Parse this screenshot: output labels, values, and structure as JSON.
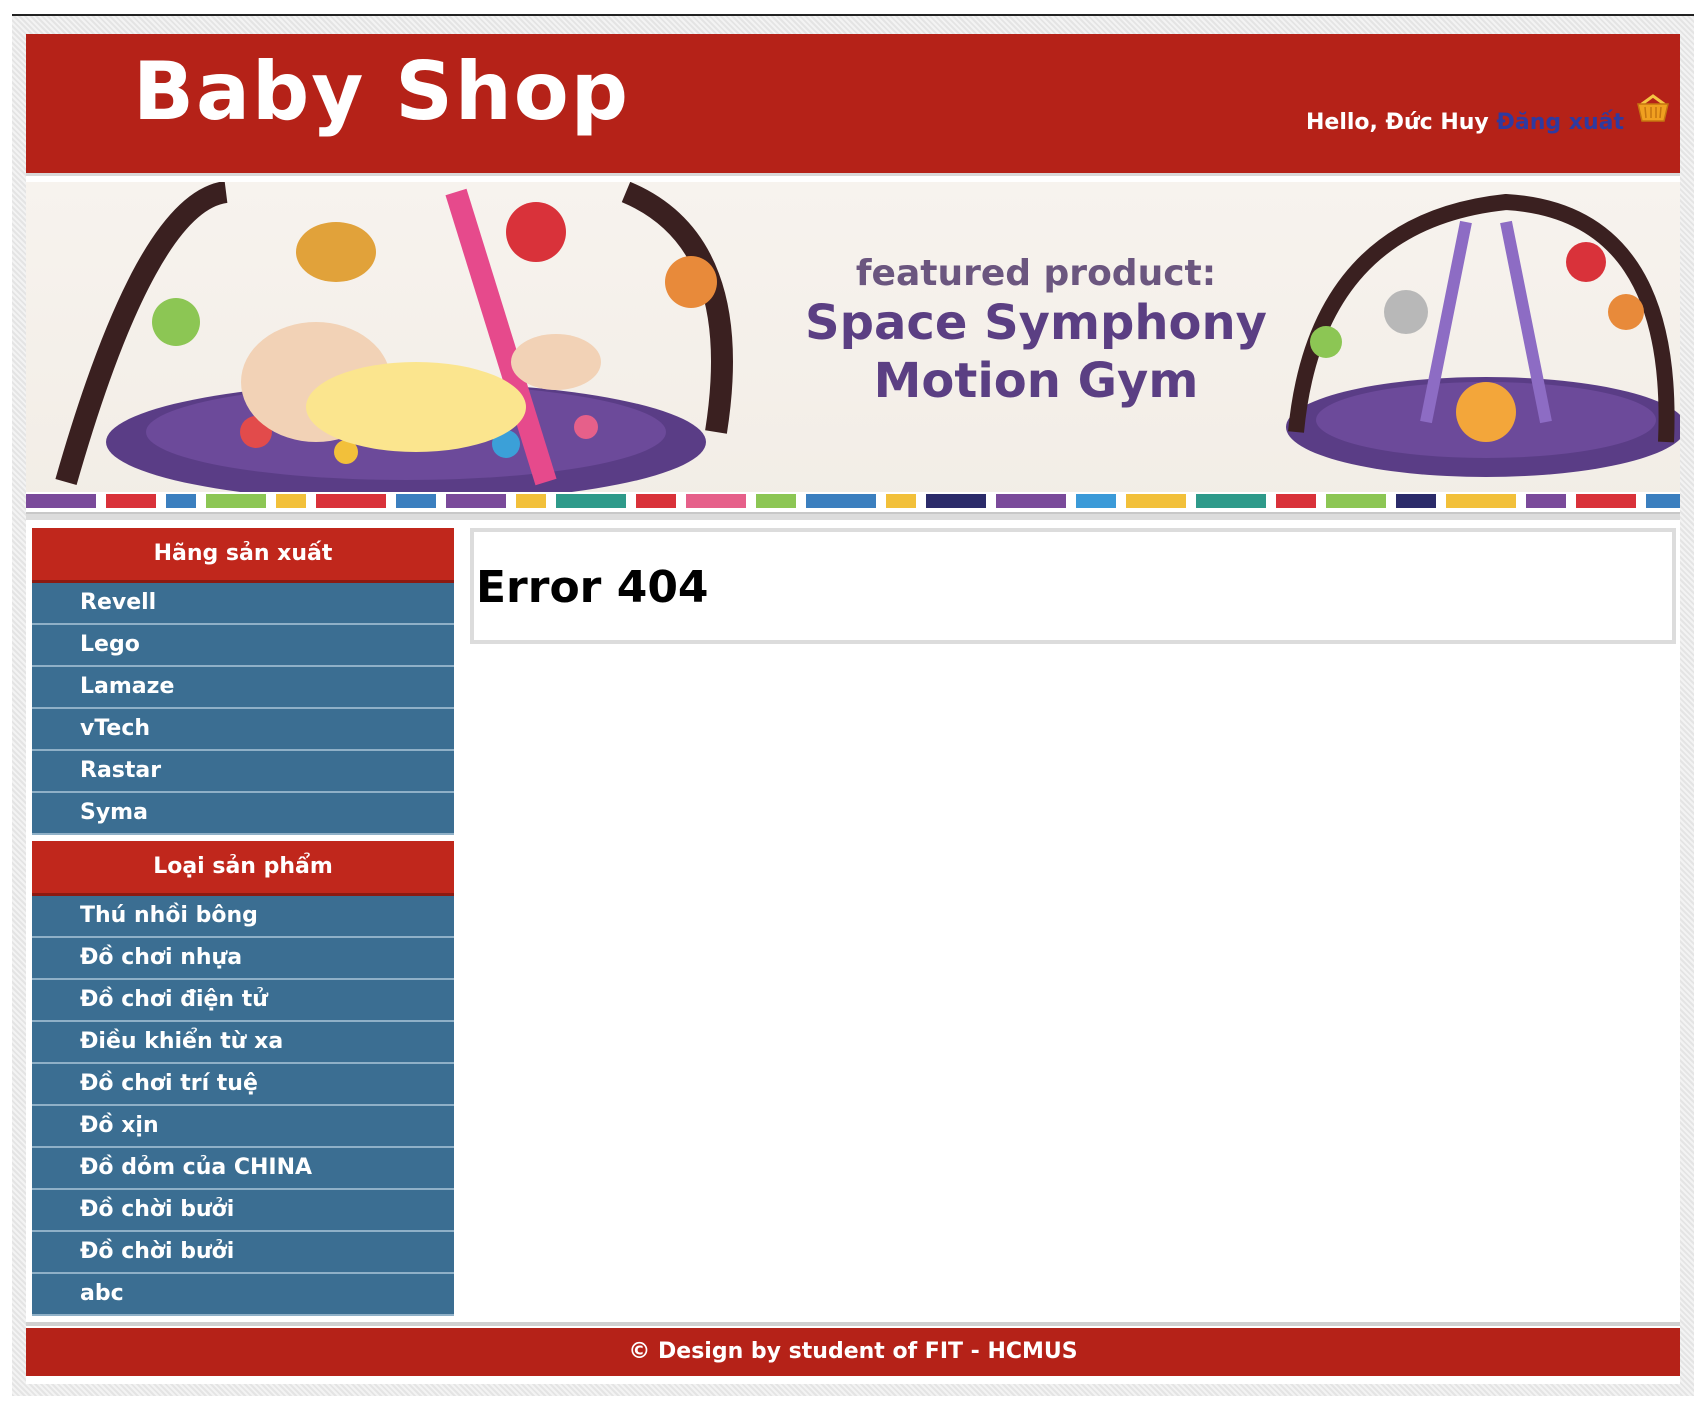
{
  "header": {
    "logo": "Baby Shop",
    "greeting": "Hello, Đức Huy",
    "logout_label": "Đăng xuất",
    "cart_icon": "basket-icon"
  },
  "banner": {
    "line1": "featured product:",
    "line2": "Space Symphony",
    "line3": "Motion Gym"
  },
  "sidebar": {
    "manufacturers_title": "Hãng sản xuất",
    "manufacturers": [
      "Revell",
      "Lego",
      "Lamaze",
      "vTech",
      "Rastar",
      "Syma"
    ],
    "categories_title": "Loại sản phẩm",
    "categories": [
      "Thú nhồi bông",
      "Đồ chơi nhựa",
      "Đồ chơi điện tử",
      "Điều khiển từ xa",
      "Đồ chơi trí tuệ",
      "Đồ xịn",
      "Đồ dỏm của CHINA",
      "Đồ chời bưởi",
      "Đồ chời bưởi",
      "abc"
    ]
  },
  "content": {
    "title": "Error 404"
  },
  "footer": {
    "text": "© Design by student of FIT - HCMUS"
  },
  "colors": {
    "header_red": "#b52218",
    "sidebar_blue": "#3b6e92",
    "logout_link": "#2f3aa0",
    "banner_purple": "#5b3f83"
  }
}
